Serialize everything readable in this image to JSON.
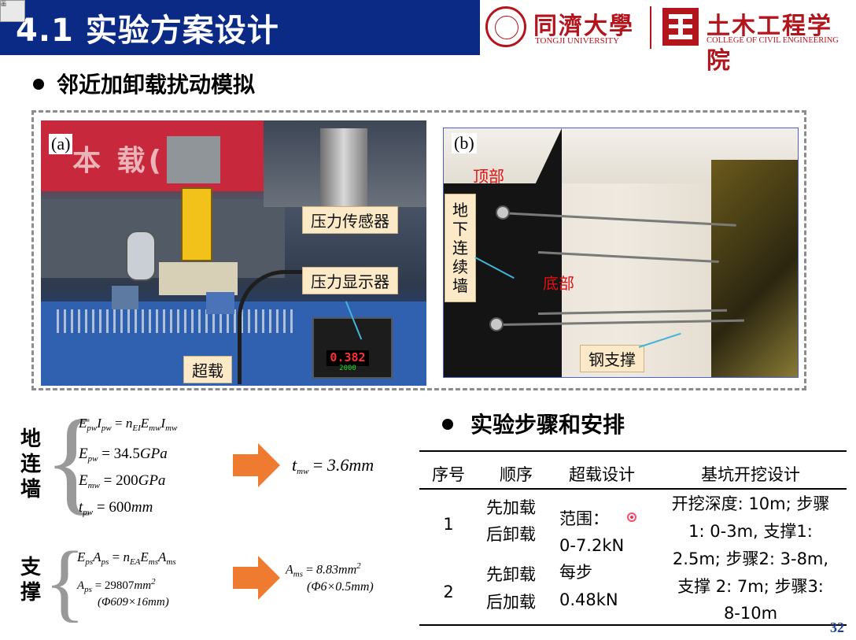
{
  "header": {
    "title": "4.1 实验方案设计",
    "corner_thumb": "画",
    "tongji_cn": "同濟大學",
    "tongji_en": "TONGJI UNIVERSITY",
    "civil_cn": "土木工程学院",
    "civil_en": "COLLEGE OF CIVIL ENGINEERING"
  },
  "section1": {
    "heading": "邻近加卸载扰动模拟",
    "photo_a": {
      "tag": "(a)",
      "callouts": {
        "sensor": "压力传感器",
        "display": "压力显示器",
        "overload": "超载"
      },
      "meter_reading": "0.382",
      "meter_setpoint": "2000"
    },
    "photo_b": {
      "tag": "(b)",
      "labels": {
        "top": "顶部",
        "bottom": "底部"
      },
      "callouts": {
        "wall": "地下连续墙",
        "strut": "钢支撑"
      }
    }
  },
  "formulas": {
    "wall_label": "地连墙",
    "strut_label": "支撑",
    "wall_result": "3.6mm",
    "strut_result": "8.83mm",
    "strut_result_note": "(Φ6×0.5mm)",
    "strut_section_note": "(Φ609×16mm)"
  },
  "section2": {
    "heading": "实验步骤和安排",
    "table": {
      "headers": [
        "序号",
        "顺序",
        "超载设计",
        "基坑开挖设计"
      ],
      "rows": [
        {
          "no": "1",
          "order_line1": "先加载",
          "order_line2": "后卸载"
        },
        {
          "no": "2",
          "order_line1": "先卸载",
          "order_line2": "后加载"
        }
      ],
      "overload_design": [
        "范围：",
        "0-7.2kN",
        "每步",
        "0.48kN"
      ],
      "excavation_design": [
        "开挖深度: 10m; 步骤",
        "1: 0-3m, 支撑1:",
        "2.5m; 步骤2: 3-8m,",
        "支撑 2: 7m; 步骤3:",
        "8-10m"
      ]
    }
  },
  "page_number": "32",
  "colors": {
    "title_bar": "#0a2a86",
    "brand_red": "#b3151d",
    "callout_bg": "#fbe9c7",
    "arrow_orange": "#ee7b2f",
    "label_red": "#e01010",
    "page_number": "#1f3f9a"
  }
}
